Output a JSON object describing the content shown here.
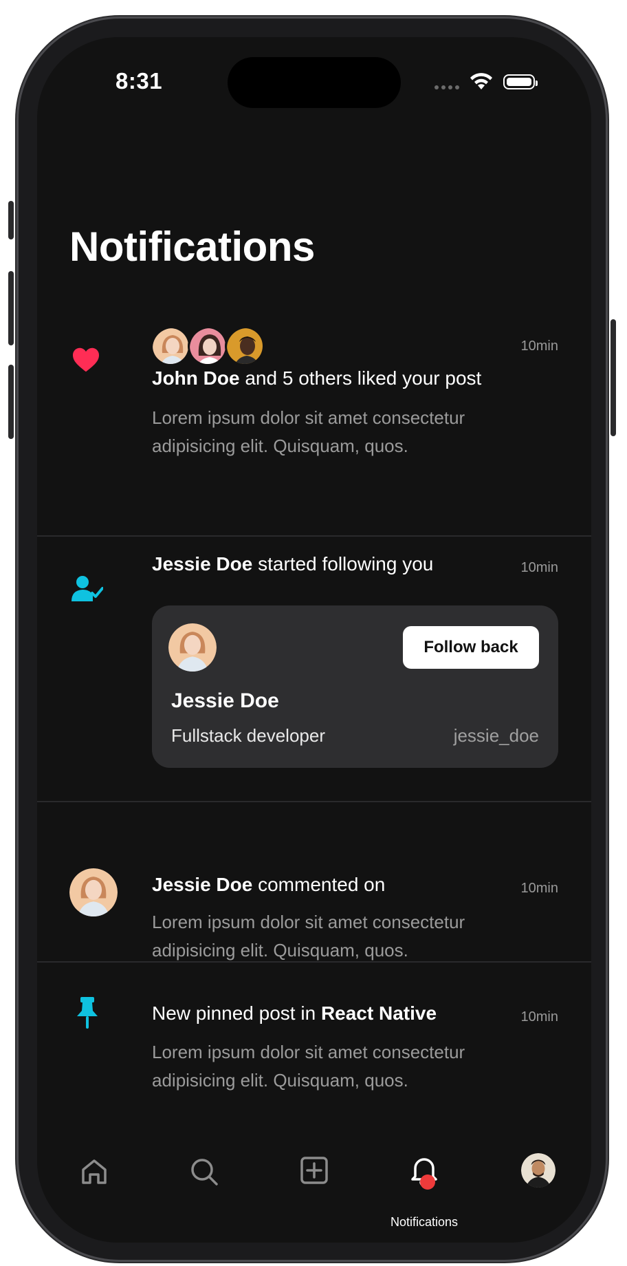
{
  "status_bar": {
    "time": "8:31"
  },
  "page_title": "Notifications",
  "notifications": [
    {
      "type": "like",
      "icon": "heart-icon",
      "icon_color": "#ff2d55",
      "time": "10min",
      "actor": "John Doe",
      "text": " and 5 others liked your post",
      "body": "Lorem ipsum dolor sit amet consectetur adipisicing elit. Quisquam, quos."
    },
    {
      "type": "follow",
      "icon": "user-check-icon",
      "icon_color": "#0fc2e0",
      "time": "10min",
      "actor": "Jessie Doe",
      "text": " started following you",
      "card": {
        "name": "Jessie Doe",
        "role": "Fullstack developer",
        "handle": "jessie_doe",
        "button_label": "Follow back"
      }
    },
    {
      "type": "comment",
      "icon": "avatar",
      "time": "10min",
      "actor": "Jessie Doe",
      "text": " commented on",
      "body": "Lorem ipsum dolor sit amet consectetur adipisicing elit. Quisquam, quos."
    },
    {
      "type": "pinned",
      "icon": "pin-icon",
      "icon_color": "#0fc2e0",
      "time": "10min",
      "prefix": "New pinned post in ",
      "group": "React Native",
      "body": "Lorem ipsum dolor sit amet consectetur adipisicing elit. Quisquam, quos."
    }
  ],
  "tab_bar": {
    "items": [
      "home-icon",
      "search-icon",
      "add-post-icon",
      "notifications-bell-icon",
      "profile-avatar"
    ],
    "active_label": "Notifications",
    "badge_color": "#ef3b3b"
  }
}
